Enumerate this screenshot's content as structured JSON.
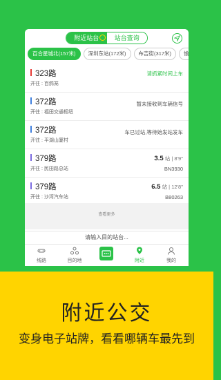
{
  "colors": {
    "primary_green": "#2bc248",
    "promo_yellow": "#ffd400"
  },
  "header": {
    "tabs": [
      {
        "label": "附近站台",
        "active": true
      },
      {
        "label": "站台查询",
        "active": false
      }
    ],
    "locate_icon": "location-arrow-icon"
  },
  "stops": [
    {
      "label": "百合星城北(157米)",
      "active": true
    },
    {
      "label": "深圳东站(172米)",
      "active": false
    },
    {
      "label": "布吉街(317米)",
      "active": false
    },
    {
      "label": "愉",
      "active": false
    }
  ],
  "routes": [
    {
      "name": "323路",
      "dest": "开往 : 百鸽笼",
      "status": "请抓紧时间上车",
      "status_type": "green",
      "bar_color": "#e53935"
    },
    {
      "name": "372路",
      "dest": "开往 : 福田交通枢纽",
      "status": "暂未接收到车辆信号",
      "status_type": "grey",
      "bar_color": "#3f7fdd"
    },
    {
      "name": "372路",
      "dest": "开往 : 平湖山厦村",
      "status": "车已过站,等待始发站发车",
      "status_type": "grey",
      "bar_color": "#3f7fdd"
    },
    {
      "name": "379路",
      "dest": "开往 : 民田路总站",
      "stops_away": "3.5",
      "stops_away_unit": "站",
      "eta": "| 8'9''",
      "plate": "BN3930",
      "bar_color": "#7a6be0"
    },
    {
      "name": "379路",
      "dest": "开往 : 沙湾汽车站",
      "stops_away": "6.5",
      "stops_away_unit": "站",
      "eta": "| 12'8''",
      "plate": "B80263",
      "bar_color": "#7a6be0"
    }
  ],
  "more_label": "查看更多",
  "destination_input": {
    "placeholder": "请输入目的站台..."
  },
  "tabbar": [
    {
      "label": "线路",
      "icon": "bus-line-icon",
      "active": false
    },
    {
      "label": "目的地",
      "icon": "destination-icon",
      "active": false
    },
    {
      "label": "",
      "icon": "bus-card-icon",
      "active": false
    },
    {
      "label": "附近",
      "icon": "nearby-pin-icon",
      "active": true
    },
    {
      "label": "我的",
      "icon": "user-icon",
      "active": false
    }
  ],
  "promo": {
    "title": "附近公交",
    "subtitle": "变身电子站牌，看看哪辆车最先到"
  }
}
